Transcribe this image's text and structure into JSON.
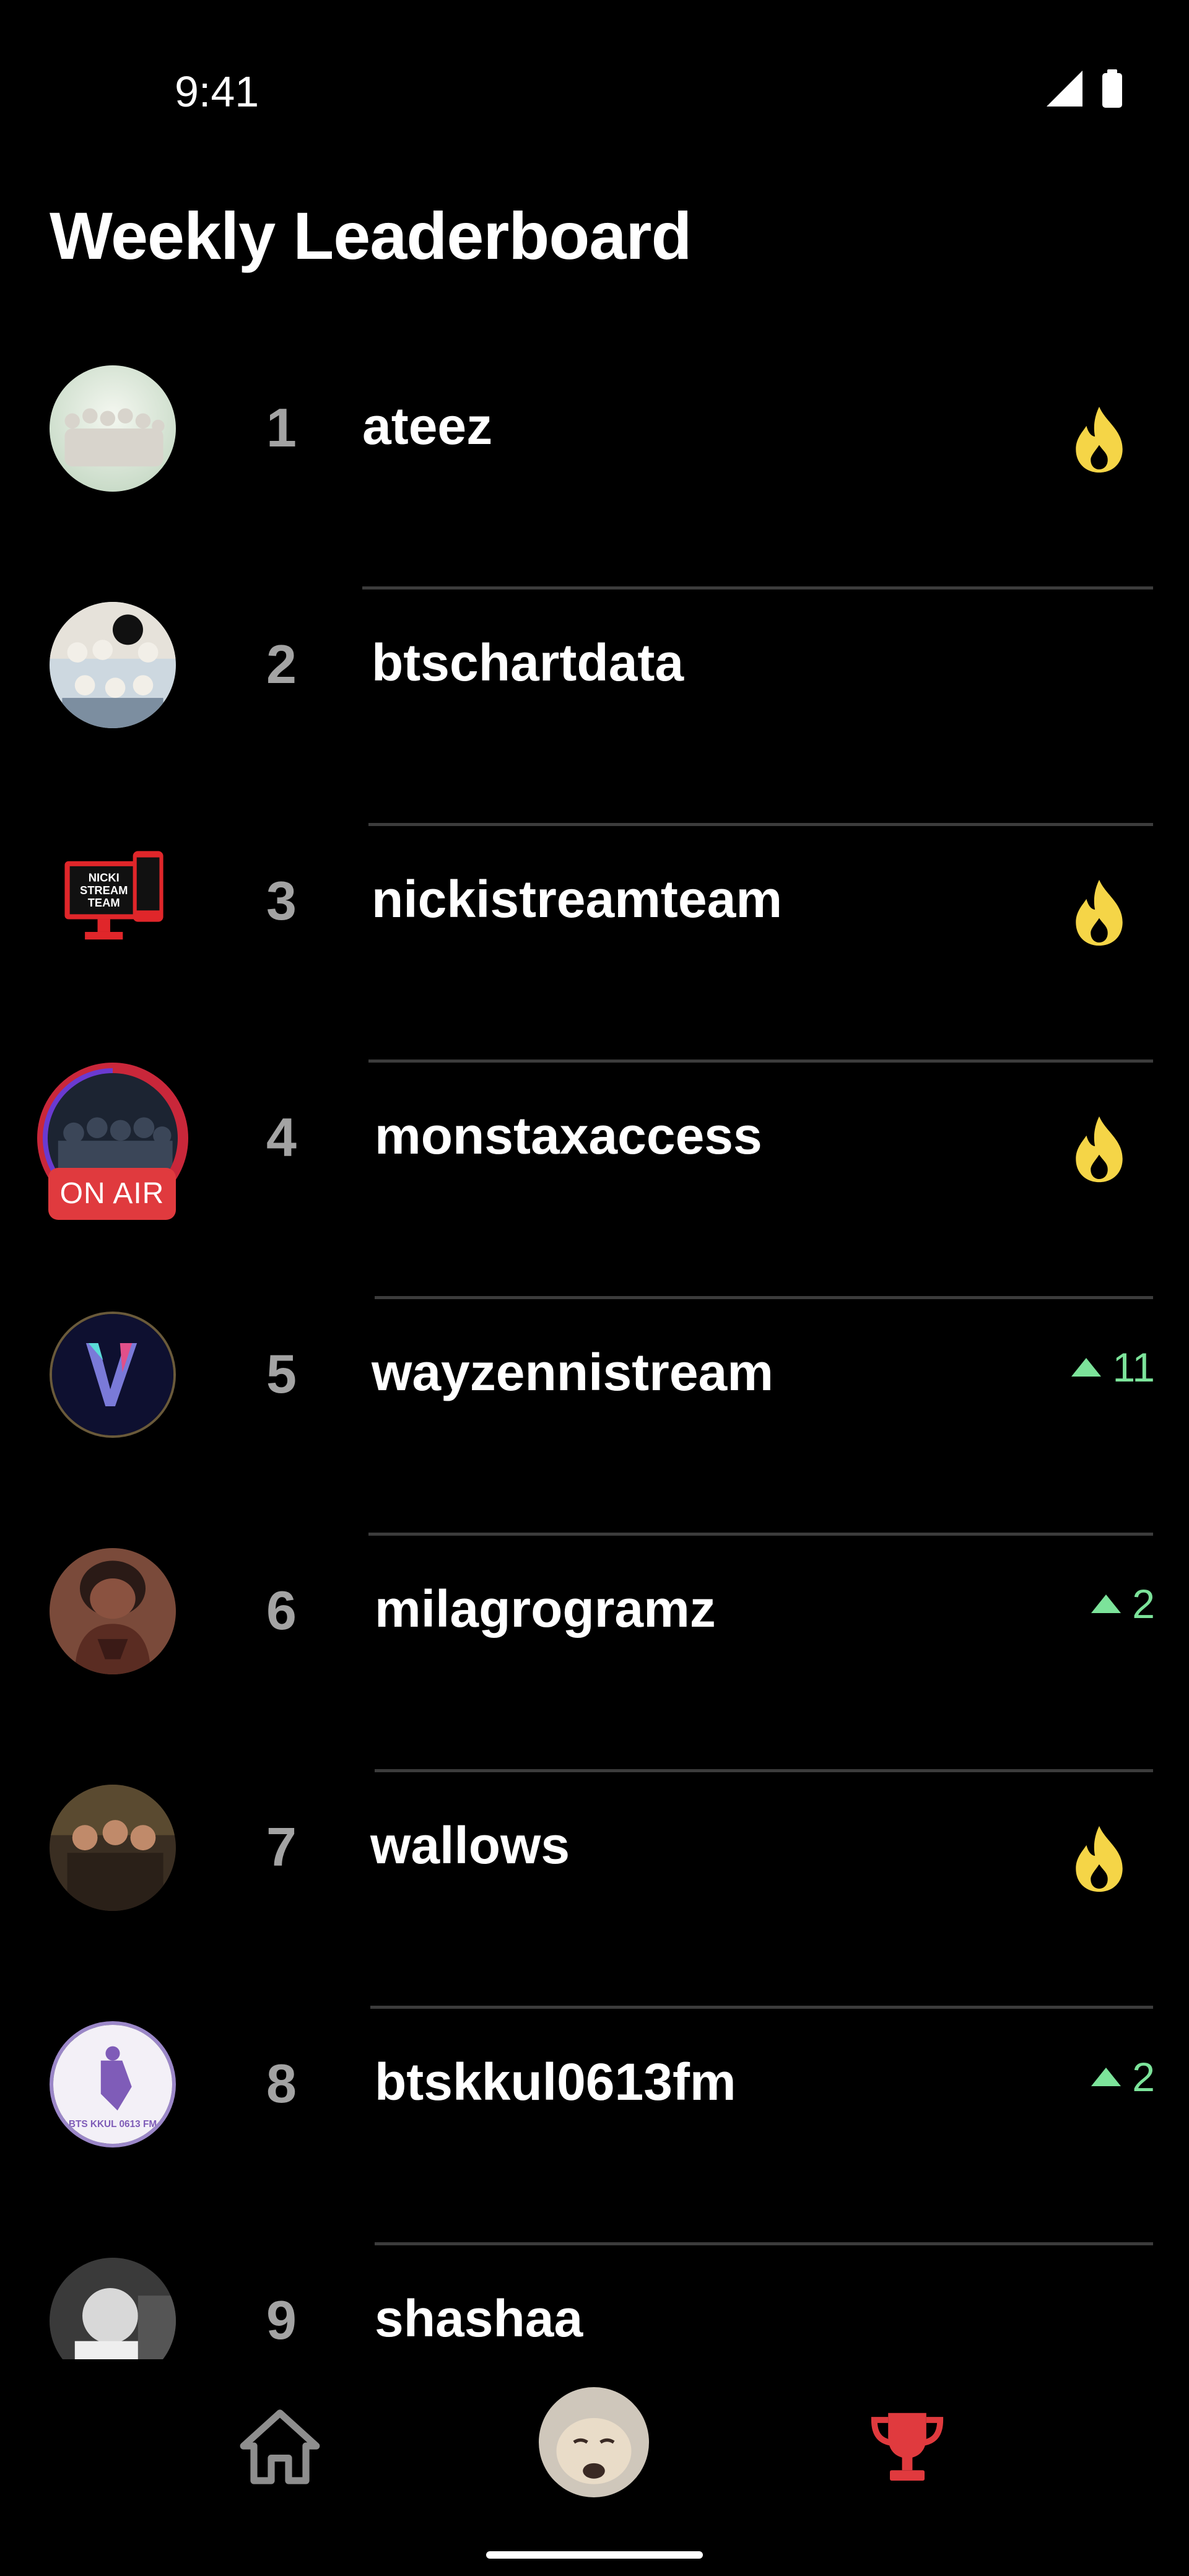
{
  "status_bar": {
    "time": "9:41",
    "icons": [
      "signal-icon",
      "battery-icon"
    ]
  },
  "page_title": "Weekly Leaderboard",
  "rows": [
    {
      "rank": "1",
      "name": "ateez",
      "badge": "fire",
      "delta": ""
    },
    {
      "rank": "2",
      "name": "btschartdata",
      "badge": "none",
      "delta": ""
    },
    {
      "rank": "3",
      "name": "nickistreamteam",
      "badge": "fire",
      "delta": "",
      "avatar_text": [
        "NICKI",
        "STREAM",
        "TEAM"
      ]
    },
    {
      "rank": "4",
      "name": "monstaxaccess",
      "badge": "fire",
      "delta": "",
      "live_label": "ON AIR"
    },
    {
      "rank": "5",
      "name": "wayzennistream",
      "badge": "up",
      "delta": "11"
    },
    {
      "rank": "6",
      "name": "milagrogramz",
      "badge": "up",
      "delta": "2"
    },
    {
      "rank": "7",
      "name": "wallows",
      "badge": "fire",
      "delta": ""
    },
    {
      "rank": "8",
      "name": "btskkul0613fm",
      "badge": "up",
      "delta": "2",
      "avatar_text": [
        "BTS KKUL 0613 FM"
      ]
    },
    {
      "rank": "9",
      "name": "shashaa",
      "badge": "none",
      "delta": ""
    }
  ],
  "bottom_nav": {
    "items": [
      "home-icon",
      "profile-avatar",
      "trophy-icon"
    ],
    "active": "trophy-icon"
  },
  "colors": {
    "background": "#000000",
    "accent_red": "#e03a3e",
    "fire_yellow": "#f5d547",
    "up_green": "#7ce39a",
    "rank_gray": "#a3a3a3"
  }
}
